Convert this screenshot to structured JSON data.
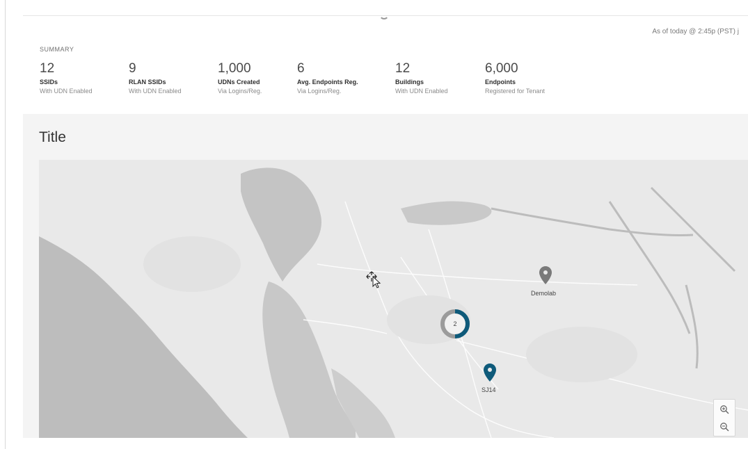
{
  "header": {
    "as_of": "As of today @ 2:45p (PST) j"
  },
  "summary": {
    "label": "SUMMARY",
    "stats": [
      {
        "value": "12",
        "name": "SSIDs",
        "sub": "With UDN Enabled"
      },
      {
        "value": "9",
        "name": "RLAN SSIDs",
        "sub": "With UDN Enabled"
      },
      {
        "value": "1,000",
        "name": "UDNs Created",
        "sub": "Via Logins/Reg."
      },
      {
        "value": "6",
        "name": "Avg. Endpoints Reg.",
        "sub": "Via Logins/Reg."
      },
      {
        "value": "12",
        "name": "Buildings",
        "sub": "With UDN Enabled"
      },
      {
        "value": "6,000",
        "name": "Endpoints",
        "sub": "Registered for Tenant"
      }
    ]
  },
  "panel": {
    "title": "Title"
  },
  "map": {
    "markers": [
      {
        "label": "Demolab",
        "color": "#7a7a7a",
        "icon": "map-pin-icon"
      },
      {
        "label": "SJ14",
        "color": "#0e5a7a",
        "icon": "map-pin-icon"
      }
    ],
    "cluster": {
      "count": "2",
      "color_primary": "#0e5a7a",
      "color_secondary": "#9b9b9b"
    },
    "zoom_in_icon": "zoom-in-icon",
    "zoom_out_icon": "zoom-out-icon",
    "colors": {
      "land": "#e9e9e9",
      "water": "#bdbdbd",
      "roads": "#ffffff"
    }
  }
}
